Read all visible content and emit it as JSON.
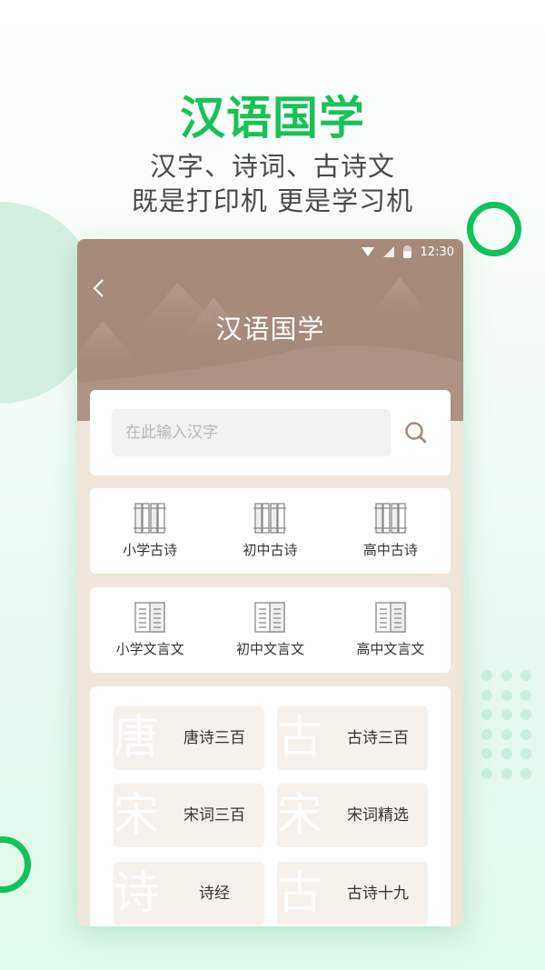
{
  "hero": {
    "title": "汉语国学",
    "subtitle_line1": "汉字、诗词、古诗文",
    "subtitle_line2": "既是打印机 更是学习机"
  },
  "status_bar": {
    "time": "12:30",
    "icons": [
      "wifi-icon",
      "signal-icon",
      "battery-icon"
    ]
  },
  "header": {
    "back_icon": "chevron-left-icon",
    "title": "汉语国学"
  },
  "search": {
    "placeholder": "在此输入汉字",
    "value": "",
    "icon": "search-icon"
  },
  "poetry_grades": [
    {
      "label": "小学古诗",
      "icon": "bamboo-scroll-icon"
    },
    {
      "label": "初中古诗",
      "icon": "bamboo-scroll-icon"
    },
    {
      "label": "高中古诗",
      "icon": "bamboo-scroll-icon"
    }
  ],
  "classical_grades": [
    {
      "label": "小学文言文",
      "icon": "open-book-icon"
    },
    {
      "label": "初中文言文",
      "icon": "open-book-icon"
    },
    {
      "label": "高中文言文",
      "icon": "open-book-icon"
    }
  ],
  "collections": [
    {
      "label": "唐诗三百",
      "watermark": "唐"
    },
    {
      "label": "古诗三百",
      "watermark": "古"
    },
    {
      "label": "宋词三百",
      "watermark": "宋"
    },
    {
      "label": "宋词精选",
      "watermark": "宋"
    },
    {
      "label": "诗经",
      "watermark": "诗"
    },
    {
      "label": "古诗十九",
      "watermark": "古"
    }
  ],
  "colors": {
    "brand_green": "#18c257",
    "header_brown": "#a68b7c",
    "page_beige": "#efe5da",
    "tile_beige": "#f6f1eb"
  }
}
